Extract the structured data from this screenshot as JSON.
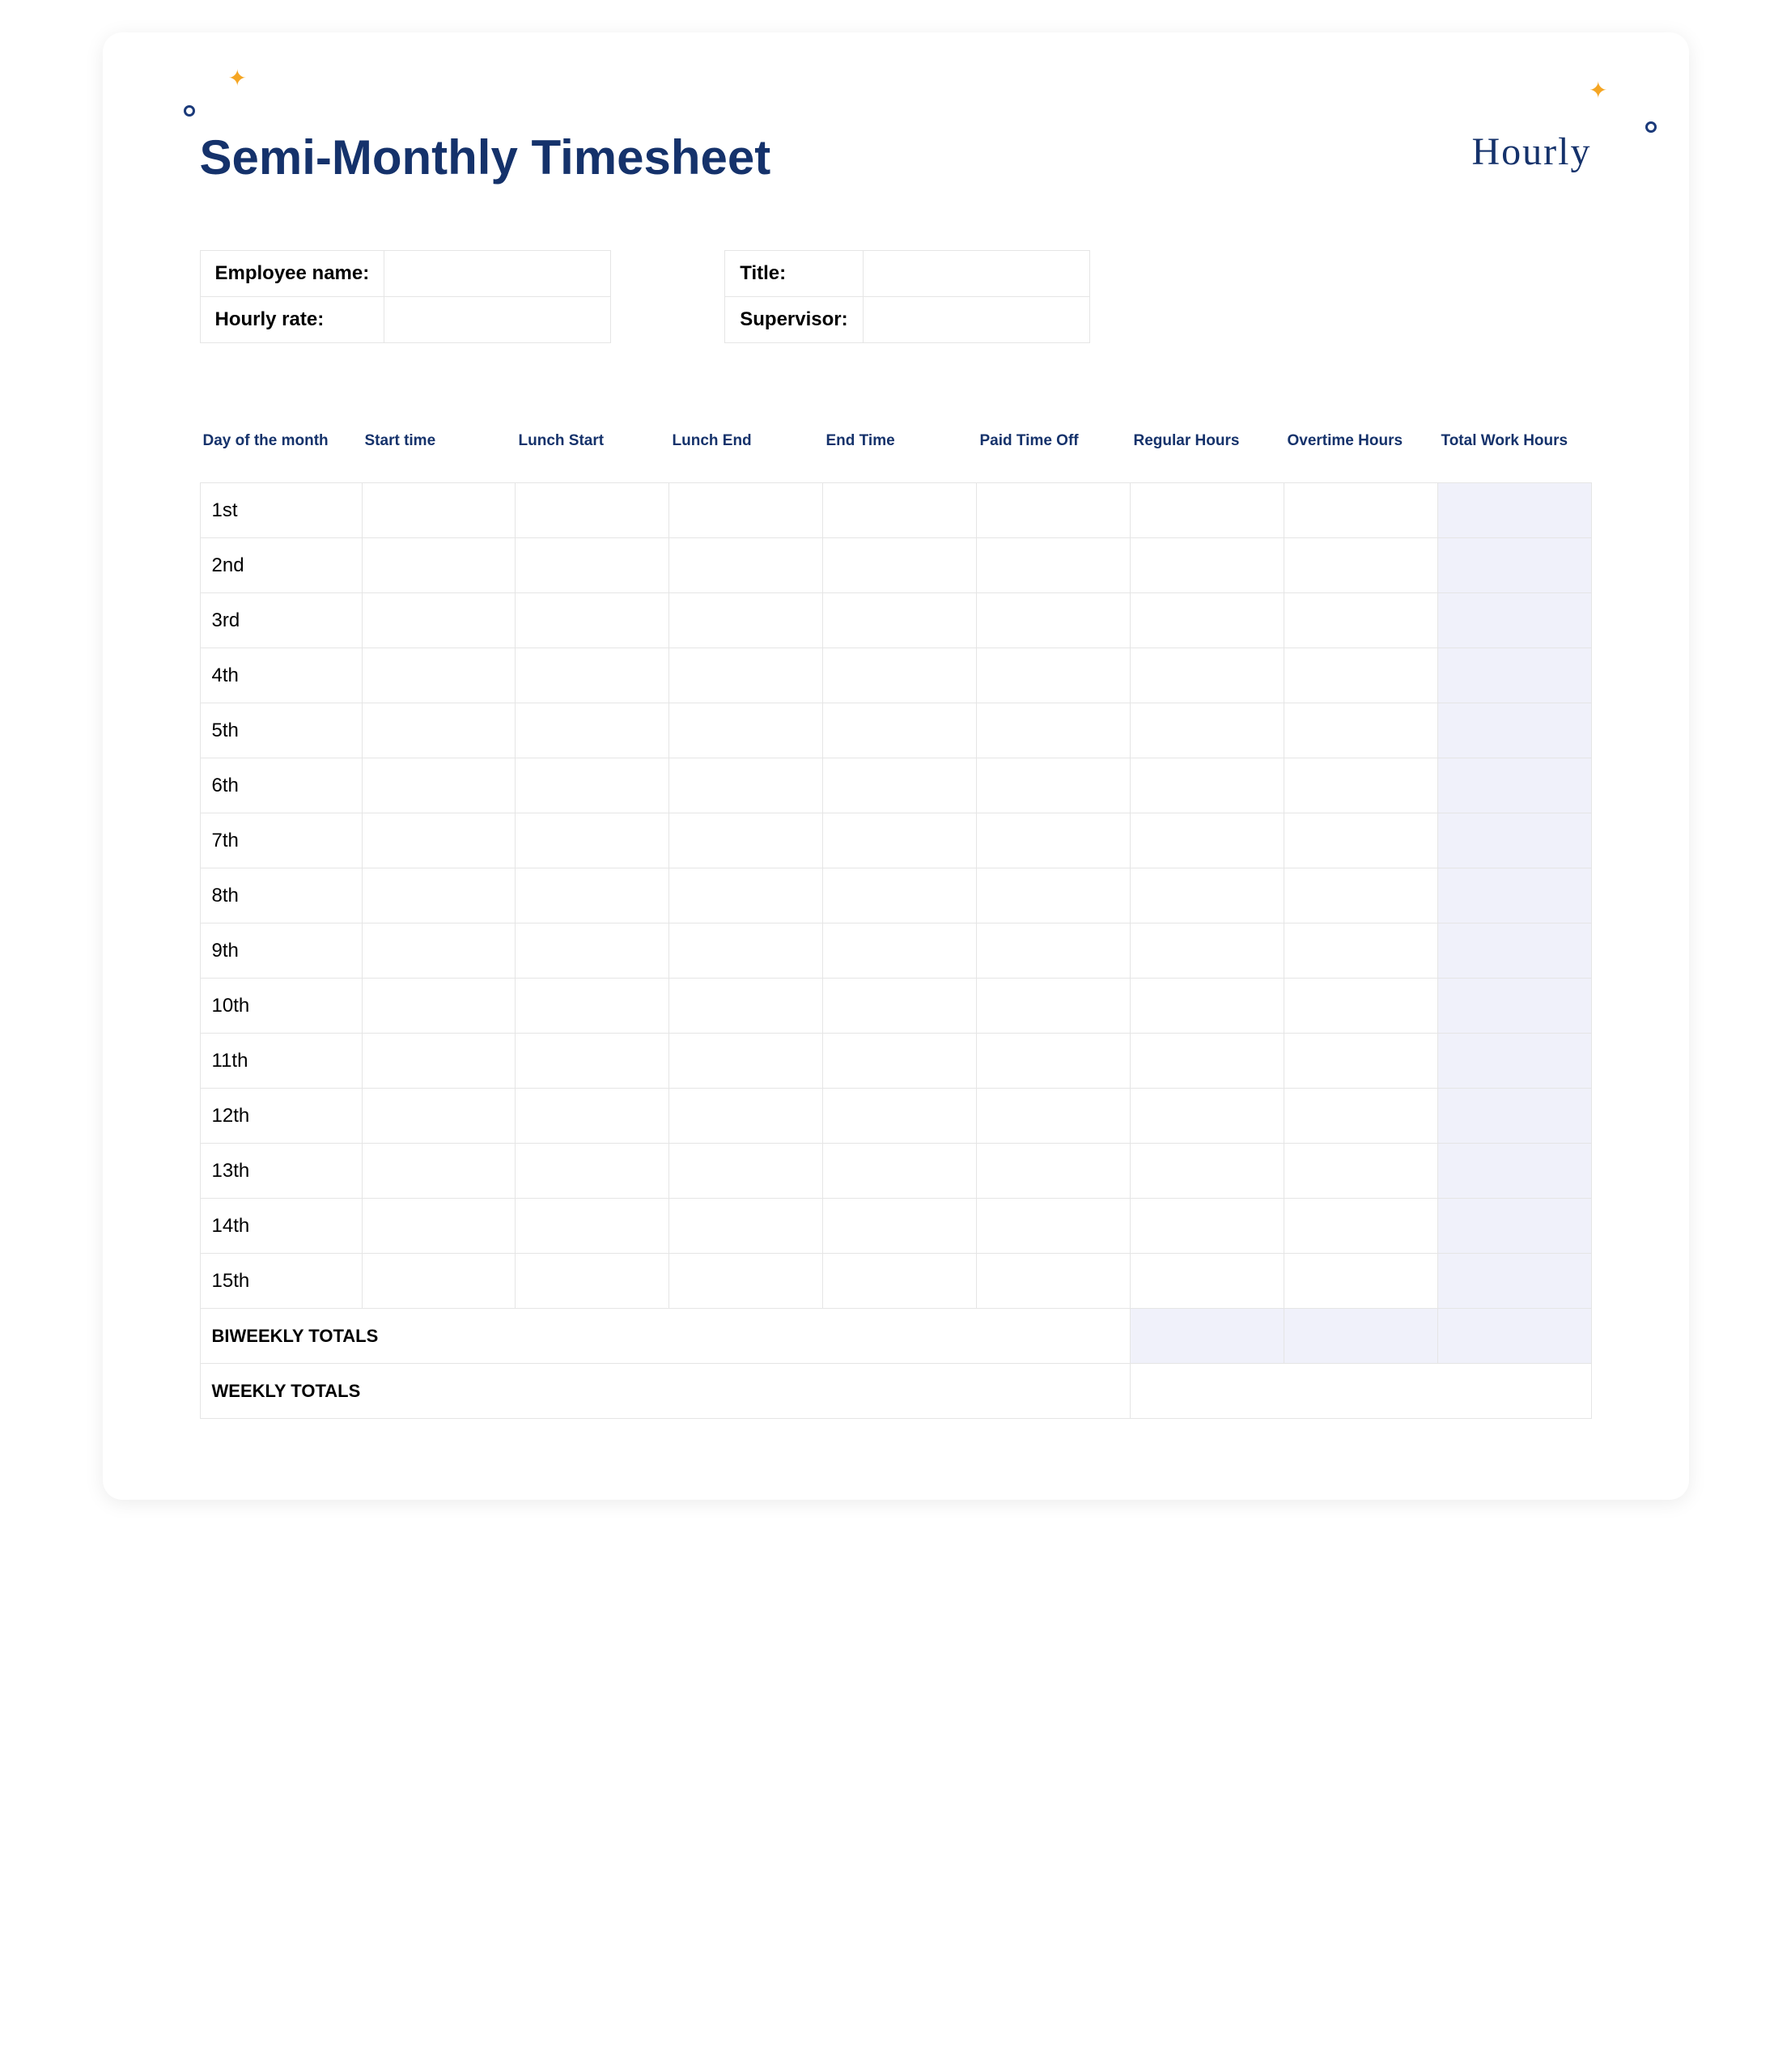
{
  "header": {
    "title": "Semi-Monthly Timesheet",
    "logo": "Hourly"
  },
  "info_left": {
    "employee_name_label": "Employee name:",
    "employee_name_value": "",
    "hourly_rate_label": "Hourly rate:",
    "hourly_rate_value": ""
  },
  "info_right": {
    "title_label": "Title:",
    "title_value": "",
    "supervisor_label": "Supervisor:",
    "supervisor_value": ""
  },
  "columns": {
    "c0": "Day of the month",
    "c1": "Start time",
    "c2": "Lunch Start",
    "c3": "Lunch End",
    "c4": "End Time",
    "c5": "Paid Time Off",
    "c6": "Regular Hours",
    "c7": "Overtime Hours",
    "c8": "Total Work Hours"
  },
  "rows": [
    {
      "day": "1st",
      "start": "",
      "lunch_start": "",
      "lunch_end": "",
      "end": "",
      "pto": "",
      "reg": "",
      "ot": "",
      "total": ""
    },
    {
      "day": "2nd",
      "start": "",
      "lunch_start": "",
      "lunch_end": "",
      "end": "",
      "pto": "",
      "reg": "",
      "ot": "",
      "total": ""
    },
    {
      "day": "3rd",
      "start": "",
      "lunch_start": "",
      "lunch_end": "",
      "end": "",
      "pto": "",
      "reg": "",
      "ot": "",
      "total": ""
    },
    {
      "day": "4th",
      "start": "",
      "lunch_start": "",
      "lunch_end": "",
      "end": "",
      "pto": "",
      "reg": "",
      "ot": "",
      "total": ""
    },
    {
      "day": "5th",
      "start": "",
      "lunch_start": "",
      "lunch_end": "",
      "end": "",
      "pto": "",
      "reg": "",
      "ot": "",
      "total": ""
    },
    {
      "day": "6th",
      "start": "",
      "lunch_start": "",
      "lunch_end": "",
      "end": "",
      "pto": "",
      "reg": "",
      "ot": "",
      "total": ""
    },
    {
      "day": "7th",
      "start": "",
      "lunch_start": "",
      "lunch_end": "",
      "end": "",
      "pto": "",
      "reg": "",
      "ot": "",
      "total": ""
    },
    {
      "day": "8th",
      "start": "",
      "lunch_start": "",
      "lunch_end": "",
      "end": "",
      "pto": "",
      "reg": "",
      "ot": "",
      "total": ""
    },
    {
      "day": "9th",
      "start": "",
      "lunch_start": "",
      "lunch_end": "",
      "end": "",
      "pto": "",
      "reg": "",
      "ot": "",
      "total": ""
    },
    {
      "day": "10th",
      "start": "",
      "lunch_start": "",
      "lunch_end": "",
      "end": "",
      "pto": "",
      "reg": "",
      "ot": "",
      "total": ""
    },
    {
      "day": "11th",
      "start": "",
      "lunch_start": "",
      "lunch_end": "",
      "end": "",
      "pto": "",
      "reg": "",
      "ot": "",
      "total": ""
    },
    {
      "day": "12th",
      "start": "",
      "lunch_start": "",
      "lunch_end": "",
      "end": "",
      "pto": "",
      "reg": "",
      "ot": "",
      "total": ""
    },
    {
      "day": "13th",
      "start": "",
      "lunch_start": "",
      "lunch_end": "",
      "end": "",
      "pto": "",
      "reg": "",
      "ot": "",
      "total": ""
    },
    {
      "day": "14th",
      "start": "",
      "lunch_start": "",
      "lunch_end": "",
      "end": "",
      "pto": "",
      "reg": "",
      "ot": "",
      "total": ""
    },
    {
      "day": "15th",
      "start": "",
      "lunch_start": "",
      "lunch_end": "",
      "end": "",
      "pto": "",
      "reg": "",
      "ot": "",
      "total": ""
    }
  ],
  "summary": {
    "biweekly_label": "BIWEEKLY TOTALS",
    "biweekly_reg": "",
    "biweekly_ot": "",
    "biweekly_total": "",
    "weekly_label": "WEEKLY TOTALS",
    "weekly_total": ""
  }
}
